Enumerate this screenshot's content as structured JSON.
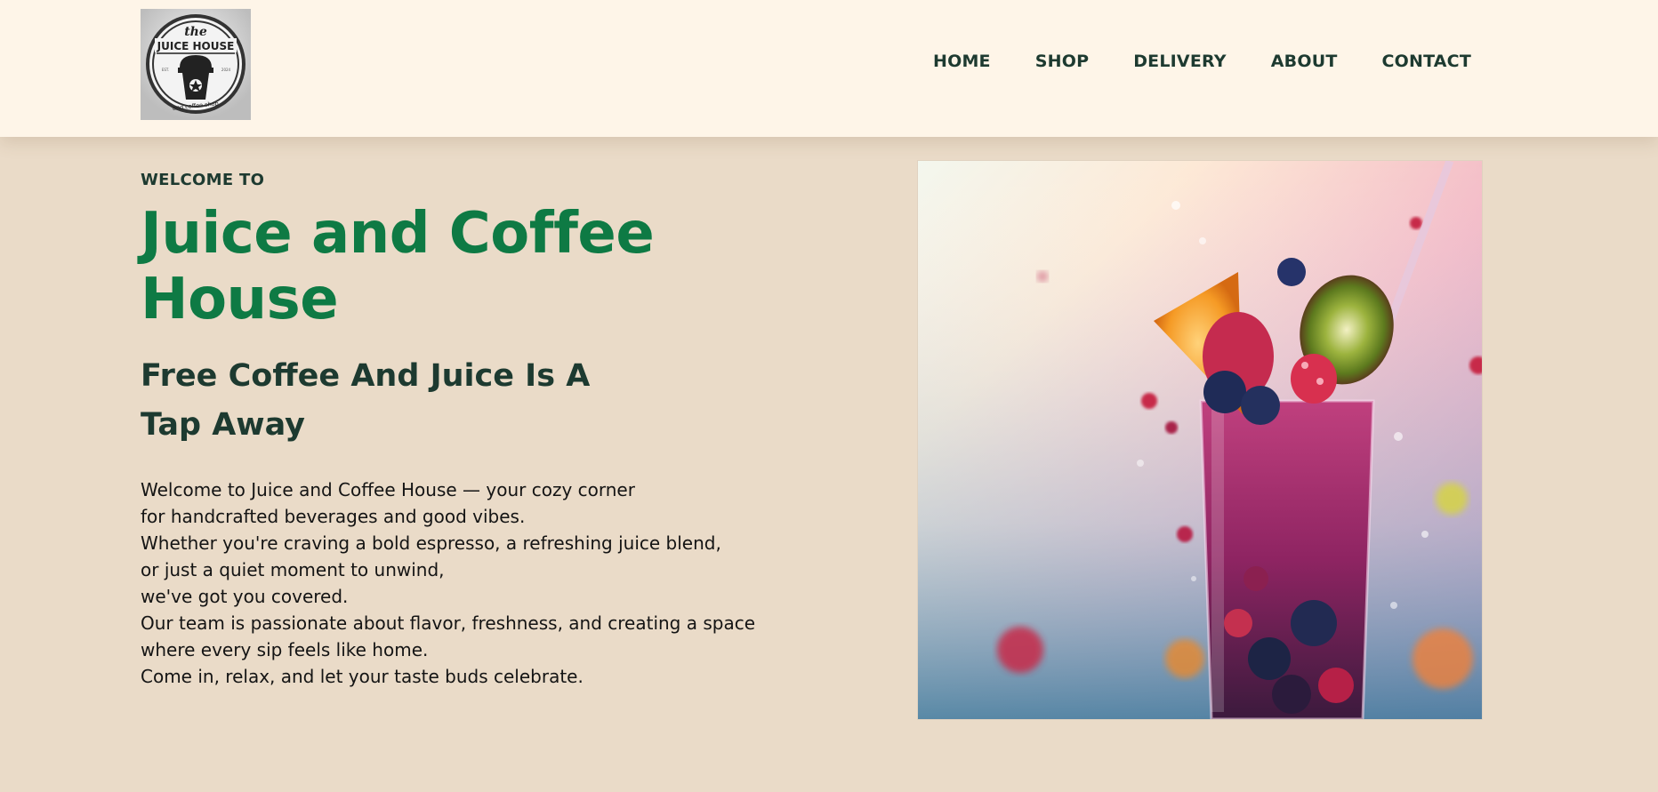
{
  "brand": {
    "logo_top": "the",
    "logo_main": "JUICE HOUSE",
    "logo_bottom": "and coffee shop",
    "logo_est": "EST.",
    "logo_year": "2024"
  },
  "nav": {
    "items": [
      {
        "label": "HOME"
      },
      {
        "label": "SHOP"
      },
      {
        "label": "DELIVERY"
      },
      {
        "label": "ABOUT"
      },
      {
        "label": "CONTACT"
      }
    ]
  },
  "hero": {
    "eyebrow": "WELCOME TO",
    "title": "Juice and Coffee House",
    "subtitle_line1": "Free Coffee And Juice Is A",
    "subtitle_line2": "Tap Away",
    "body_lines": [
      "Welcome to Juice and Coffee House — your cozy corner",
      "for handcrafted beverages and good vibes.",
      "Whether you're craving a bold espresso, a refreshing juice blend,",
      "or just a quiet moment to unwind,",
      "we've got you covered.",
      "Our team is passionate about flavor, freshness, and creating a space",
      "where every sip feels like home.",
      "Come in, relax, and let your taste buds celebrate."
    ]
  },
  "colors": {
    "header_bg": "#fef5e8",
    "page_bg": "#eadbc8",
    "accent_green": "#0e7a44",
    "dark_text": "#1d3a30"
  },
  "icons": {
    "logo": "cup-logo-icon",
    "hero_image": "smoothie-glass-image"
  }
}
